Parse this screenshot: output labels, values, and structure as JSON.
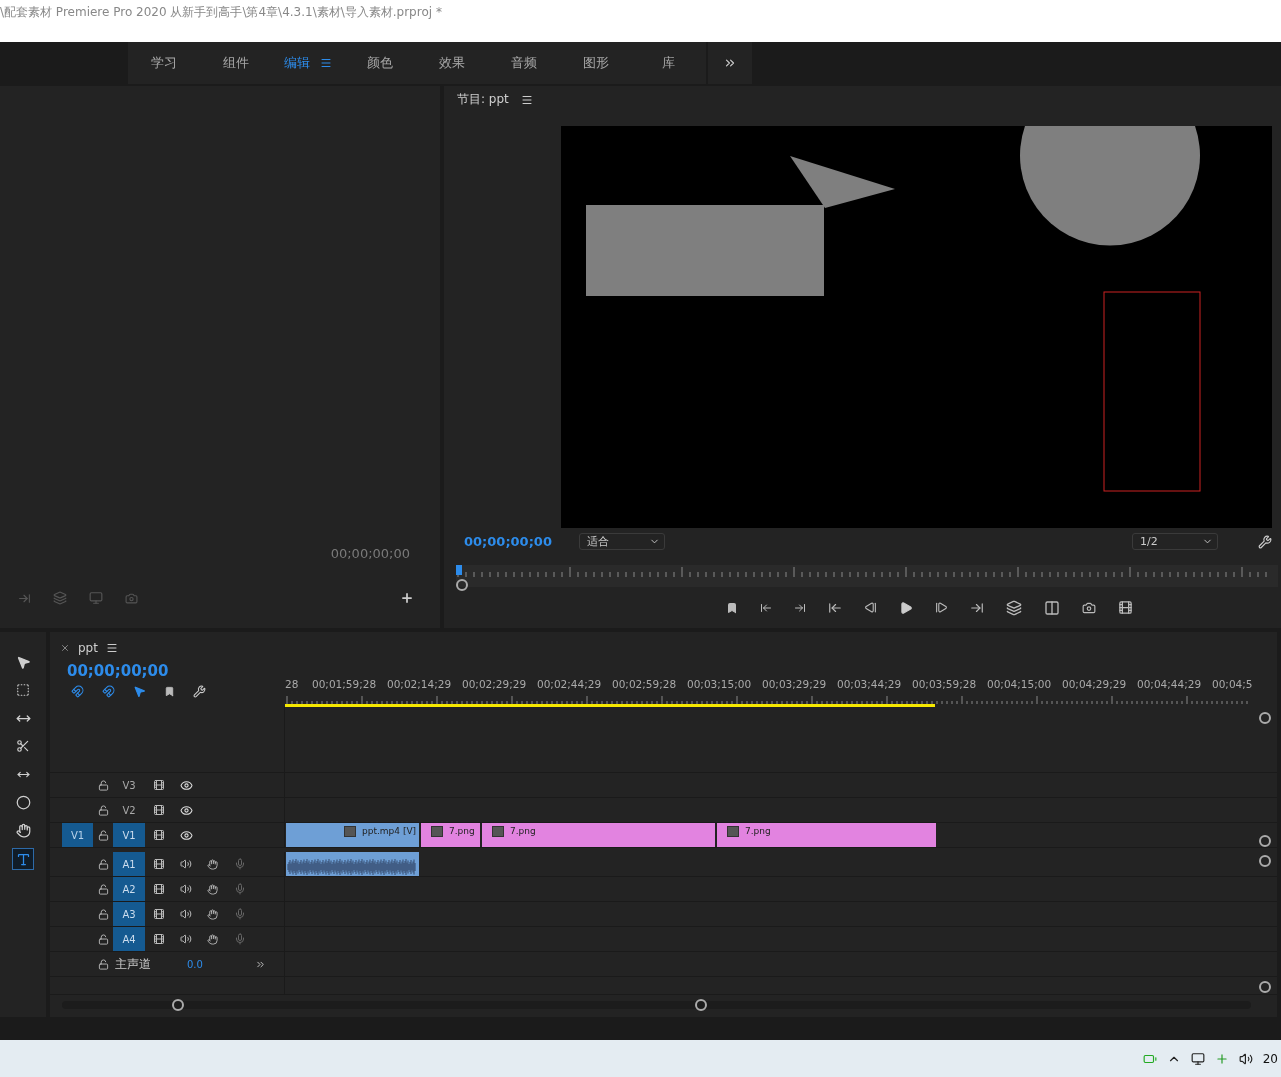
{
  "title_bar": {
    "title": "\\配套素材 Premiere Pro 2020 从新手到高手\\第4章\\4.3.1\\素材\\导入素材.prproj *"
  },
  "workspaces": [
    {
      "label": "学习",
      "selected": false
    },
    {
      "label": "组件",
      "selected": false
    },
    {
      "label": "编辑",
      "selected": true
    },
    {
      "label": "颜色",
      "selected": false
    },
    {
      "label": "效果",
      "selected": false
    },
    {
      "label": "音频",
      "selected": false
    },
    {
      "label": "图形",
      "selected": false
    },
    {
      "label": "库",
      "selected": false
    }
  ],
  "source_monitor": {
    "timecode": "00;00;00;00"
  },
  "program_monitor": {
    "title": "节目: ppt",
    "timecode": "00;00;00;00",
    "zoom": "适合",
    "resolution": "1/2",
    "playhead": {
      "level": 0
    }
  },
  "timeline": {
    "sequence": "ppt",
    "timecode": "00;00;00;00",
    "ruler": [
      "28",
      "00;01;59;28",
      "00;02;14;29",
      "00;02;29;29",
      "00;02;44;29",
      "00;02;59;28",
      "00;03;15;00",
      "00;03;29;29",
      "00;03;44;29",
      "00;03;59;28",
      "00;04;15;00",
      "00;04;29;29",
      "00;04;44;29",
      "00;04;5"
    ],
    "work_area": {
      "level": 0.672
    },
    "tracks": [
      {
        "kind": "video",
        "name": "V3",
        "targeted": false
      },
      {
        "kind": "video",
        "name": "V2",
        "targeted": false
      },
      {
        "kind": "video",
        "name": "V1",
        "source_patch": "V1",
        "targeted": true,
        "clips": [
          {
            "name": "ppt.mp4 [V]",
            "color": "#6e9fd6"
          },
          {
            "name": "7.png",
            "color": "#e283e0"
          },
          {
            "name": "7.png",
            "color": "#e283e0"
          },
          {
            "name": "7.png",
            "color": "#e283e0"
          }
        ]
      },
      {
        "kind": "audio",
        "name": "A1",
        "targeted": true,
        "clips": [
          {
            "color": "#6e9fd6"
          }
        ]
      },
      {
        "kind": "audio",
        "name": "A2",
        "targeted": true
      },
      {
        "kind": "audio",
        "name": "A3",
        "targeted": true
      },
      {
        "kind": "audio",
        "name": "A4",
        "targeted": true
      }
    ],
    "master": {
      "label": "主声道",
      "value": "0.0"
    }
  },
  "taskbar": {
    "clock": "20"
  }
}
